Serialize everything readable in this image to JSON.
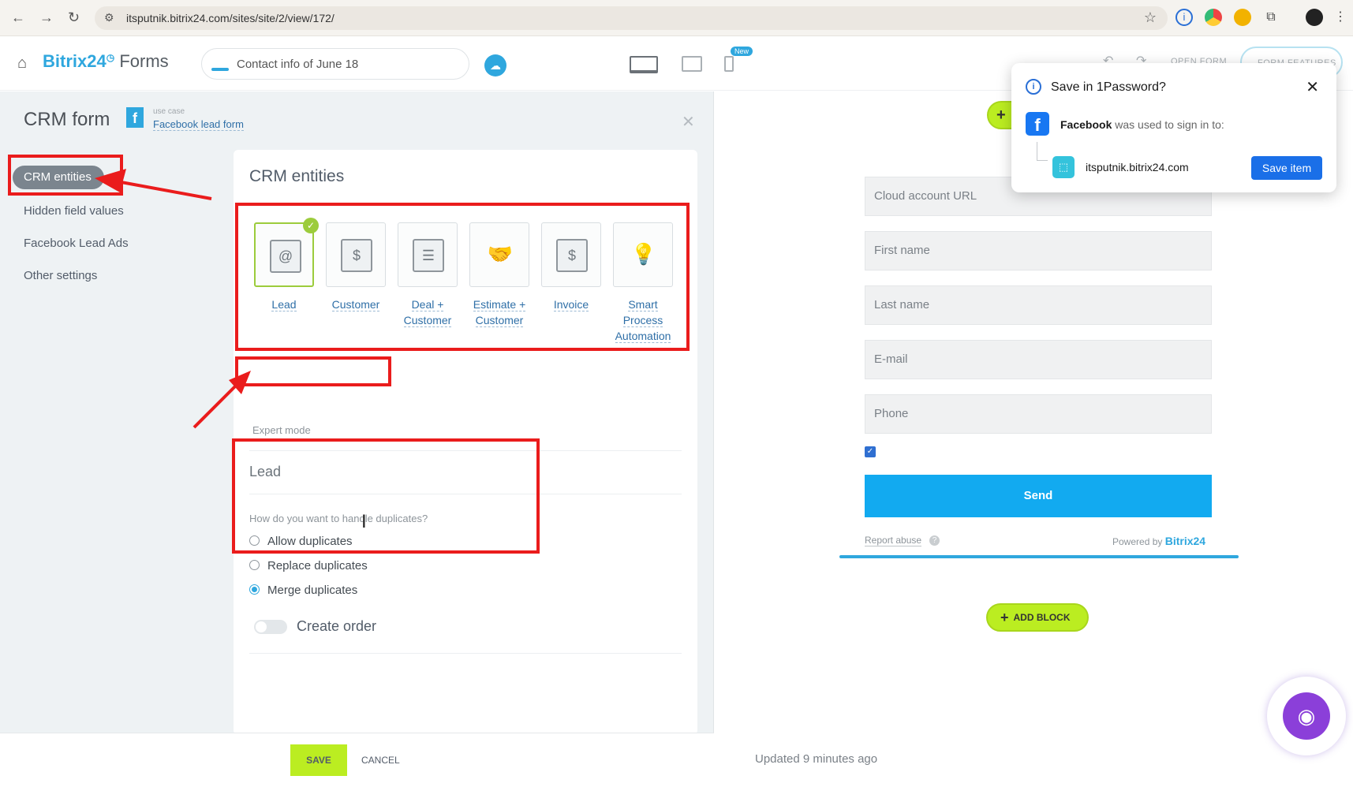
{
  "browser": {
    "url": "itsputnik.bitrix24.com/sites/site/2/view/172/"
  },
  "app": {
    "brand": "Bitrix24",
    "brand_suffix": "Forms",
    "form_name": "Contact info of June 18",
    "new_badge": "New",
    "open_form": "OPEN FORM",
    "form_features": "FORM FEATURES"
  },
  "panel": {
    "title": "CRM form",
    "use_case_label": "use case",
    "use_case_value": "Facebook lead form",
    "menu": [
      {
        "label": "CRM entities",
        "active": true
      },
      {
        "label": "Hidden field values"
      },
      {
        "label": "Facebook Lead Ads"
      },
      {
        "label": "Other settings"
      }
    ],
    "card_title": "CRM entities",
    "entities": [
      {
        "label": "Lead",
        "selected": true
      },
      {
        "label": "Customer"
      },
      {
        "label": "Deal + Customer"
      },
      {
        "label": "Estimate + Customer"
      },
      {
        "label": "Invoice"
      },
      {
        "label": "Smart Process Automation"
      }
    ],
    "expert_mode": "Expert mode",
    "section": "Lead",
    "duplicates_question": "How do you want to handle duplicates?",
    "duplicates_options": [
      "Allow duplicates",
      "Replace duplicates",
      "Merge duplicates"
    ],
    "duplicates_selected": "Merge duplicates",
    "create_order": "Create order",
    "save": "SAVE",
    "cancel": "CANCEL"
  },
  "preview": {
    "fields": [
      "Cloud account URL",
      "First name",
      "Last name",
      "E-mail",
      "Phone"
    ],
    "send": "Send",
    "report_abuse": "Report abuse",
    "powered_by": "Powered by",
    "powered_brand": "Bitrix24",
    "add_block": "ADD BLOCK",
    "updated": "Updated 9 minutes ago"
  },
  "onepassword": {
    "title": "Save in 1Password?",
    "provider": "Facebook",
    "message": "was used to sign in to:",
    "site": "itsputnik.bitrix24.com",
    "save_button": "Save item"
  },
  "colors": {
    "accent": "#2fa7de",
    "save_green": "#bbed21",
    "annotation_red": "#ea1c1c",
    "send_blue": "#12aaf0"
  }
}
